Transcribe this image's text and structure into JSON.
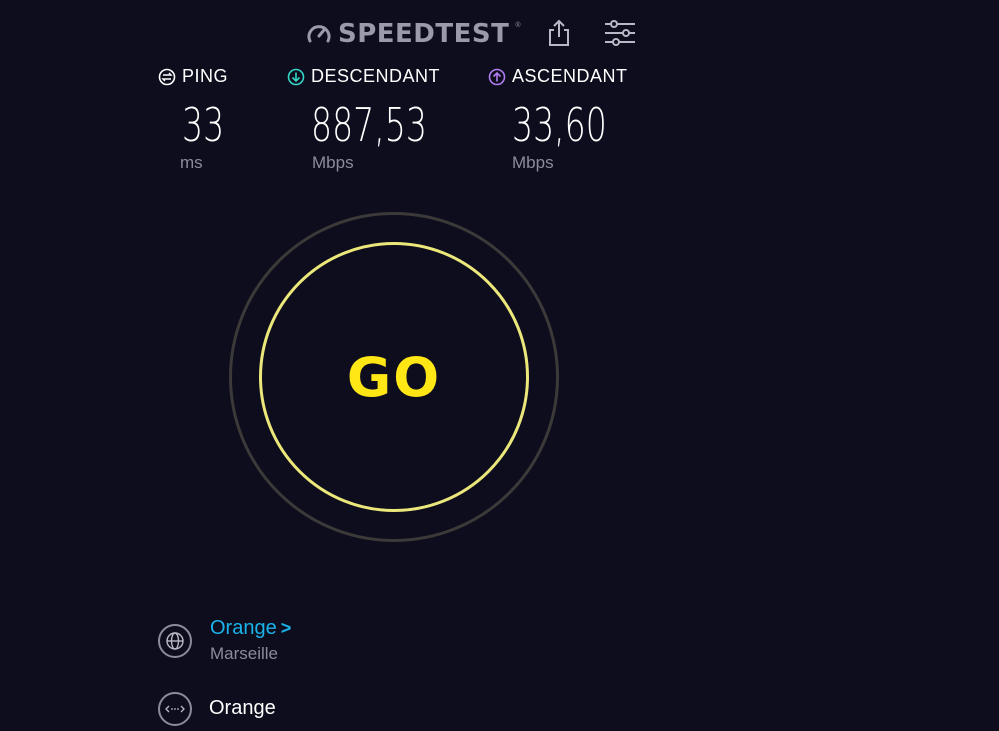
{
  "header": {
    "logo_text": "SPEEDTEST",
    "logo_reg": "®",
    "icons": [
      "speedometer-icon",
      "share-icon",
      "settings-sliders-icon"
    ]
  },
  "metrics": {
    "ping": {
      "label": "PING",
      "value": "33",
      "unit": "ms",
      "icon": "ping-icon",
      "color": "#ffffff"
    },
    "download": {
      "label": "DESCENDANT",
      "value": "887,53",
      "unit": "Mbps",
      "icon": "download-arrow-icon",
      "color": "#34d6c6"
    },
    "upload": {
      "label": "ASCENDANT",
      "value": "33,60",
      "unit": "Mbps",
      "icon": "upload-arrow-icon",
      "color": "#b07cf0"
    }
  },
  "go_button": {
    "label": "GO",
    "color": "#ffe716",
    "ring_color": "#ebe77a"
  },
  "server": {
    "name": "Orange",
    "chevron": ">",
    "location": "Marseille",
    "icon": "globe-icon"
  },
  "isp": {
    "name": "Orange",
    "icon": "connection-dots-icon"
  },
  "colors": {
    "background": "#0d0d1d",
    "link": "#1ab3ea",
    "muted": "#8b8b9b"
  }
}
